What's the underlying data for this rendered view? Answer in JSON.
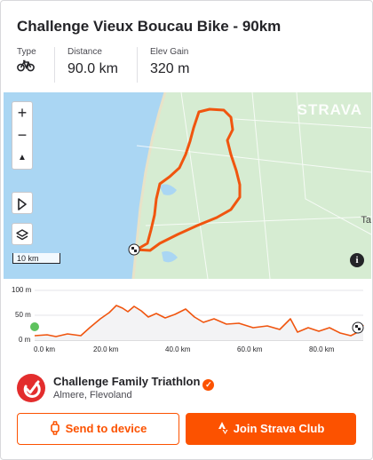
{
  "route": {
    "title": "Challenge Vieux Boucau Bike - 90km"
  },
  "stats": [
    {
      "label": "Type",
      "icon": "bike-icon"
    },
    {
      "label": "Distance",
      "value": "90.0 km"
    },
    {
      "label": "Elev Gain",
      "value": "320 m"
    }
  ],
  "map": {
    "zoom_in": "+",
    "zoom_out": "−",
    "scale_label": "10 km",
    "brand": "STRAVA",
    "town_labels": [
      "Ta"
    ],
    "info": "i"
  },
  "elevation": {
    "y_ticks": [
      "100 m",
      "50 m",
      "0 m"
    ],
    "x_ticks": [
      "0.0 km",
      "20.0 km",
      "40.0 km",
      "60.0 km",
      "80.0 km"
    ]
  },
  "club": {
    "name": "Challenge Family Triathlon",
    "location": "Almere, Flevoland",
    "verified": true
  },
  "actions": {
    "send": "Send to device",
    "join": "Join Strava Club"
  },
  "colors": {
    "accent": "#fc5200",
    "route": "#f0550f",
    "sea": "#a9d5f2",
    "land": "#d4ecd0"
  }
}
